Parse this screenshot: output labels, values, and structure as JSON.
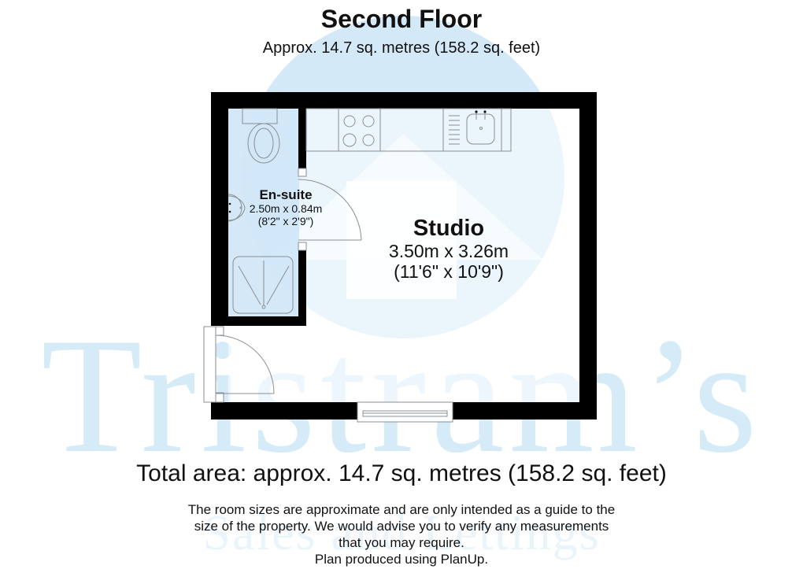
{
  "watermark": {
    "brand": "Tristram’s",
    "tagline": "Sales and Lettings",
    "color": "#d6ebf8"
  },
  "header": {
    "title": "Second Floor",
    "subtitle": "Approx. 14.7 sq. metres (158.2 sq. feet)"
  },
  "rooms": [
    {
      "name": "Studio",
      "metric": "3.50m x 3.26m",
      "imperial": "(11'6\" x 10'9\")"
    },
    {
      "name": "En-suite",
      "metric": "2.50m x 0.84m",
      "imperial": "(8'2\" x 2'9\")",
      "fill": "#cfe6f7"
    }
  ],
  "fixtures": [
    "hob",
    "sink-drainer",
    "toilet",
    "wash-basin",
    "shower-tray",
    "entrance-door",
    "en-suite-door",
    "window"
  ],
  "footer": {
    "total_area": "Total area: approx. 14.7 sq. metres (158.2 sq. feet)",
    "disclaimer_lines": [
      "The room sizes are approximate and are only intended as a guide to the",
      "size of the property. We would advise you to verify any measurements",
      "that you may require.",
      "Plan produced using PlanUp."
    ]
  },
  "colors": {
    "wall": "#000000",
    "fixture_line": "#8a8f94",
    "ensuite_fill": "#cfe6f7",
    "watermark": "#d6ebf8"
  }
}
